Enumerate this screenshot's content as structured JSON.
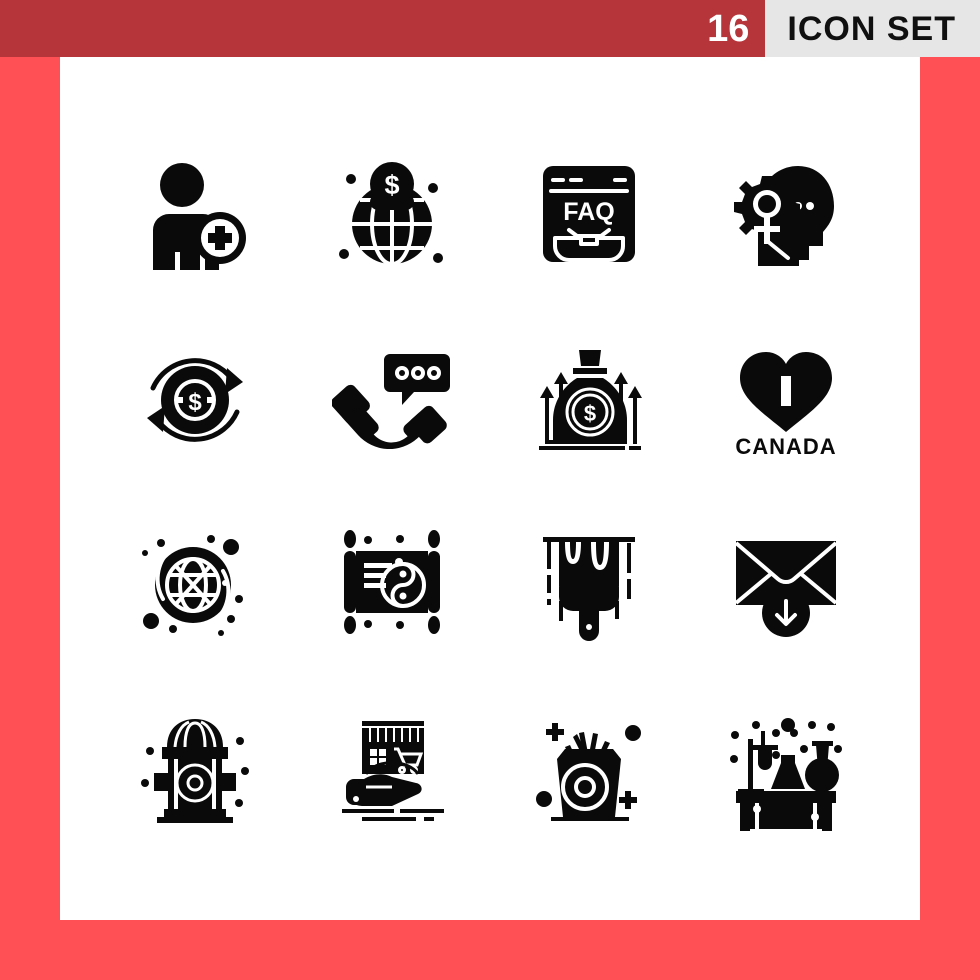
{
  "header": {
    "count": "16",
    "title": "ICON SET",
    "count_bg": "#b5353b",
    "title_bg": "#e6e6e6",
    "title_color": "#101010",
    "count_color": "#ffffff"
  },
  "poster": {
    "border_color": "#ff5056",
    "canvas_color": "#ffffff",
    "icon_color": "#0a0a0a",
    "columns": 4,
    "rows": 4
  },
  "icons": [
    {
      "position": 1,
      "row": 1,
      "col": 1,
      "name": "add-user-icon",
      "label": "Add User"
    },
    {
      "position": 2,
      "row": 1,
      "col": 2,
      "name": "global-finance-icon",
      "label": "Global Finance"
    },
    {
      "position": 3,
      "row": 1,
      "col": 3,
      "name": "faq-browser-icon",
      "label": "FAQ",
      "text": "FAQ"
    },
    {
      "position": 4,
      "row": 1,
      "col": 4,
      "name": "mind-gear-head-icon",
      "label": "Creative Mind"
    },
    {
      "position": 5,
      "row": 2,
      "col": 1,
      "name": "money-refund-icon",
      "label": "Money Refund"
    },
    {
      "position": 6,
      "row": 2,
      "col": 2,
      "name": "phone-support-chat-icon",
      "label": "Phone Support"
    },
    {
      "position": 7,
      "row": 2,
      "col": 3,
      "name": "money-bag-growth-icon",
      "label": "Money Growth"
    },
    {
      "position": 8,
      "row": 2,
      "col": 4,
      "name": "i-love-canada-heart-icon",
      "label": "I Love Canada",
      "text": "CANADA"
    },
    {
      "position": 9,
      "row": 3,
      "col": 1,
      "name": "planet-globe-icon",
      "label": "Planet"
    },
    {
      "position": 10,
      "row": 3,
      "col": 2,
      "name": "yin-yang-scroll-icon",
      "label": "Yin Yang Scroll"
    },
    {
      "position": 11,
      "row": 3,
      "col": 3,
      "name": "paint-brush-drip-icon",
      "label": "Paint Brush"
    },
    {
      "position": 12,
      "row": 3,
      "col": 4,
      "name": "email-download-icon",
      "label": "Receive Email"
    },
    {
      "position": 13,
      "row": 4,
      "col": 1,
      "name": "fire-hydrant-icon",
      "label": "Fire Hydrant"
    },
    {
      "position": 14,
      "row": 4,
      "col": 2,
      "name": "hand-shop-icon",
      "label": "Shop in Hand"
    },
    {
      "position": 15,
      "row": 4,
      "col": 3,
      "name": "french-fries-icon",
      "label": "French Fries"
    },
    {
      "position": 16,
      "row": 4,
      "col": 4,
      "name": "lab-table-icon",
      "label": "Laboratory Table"
    }
  ]
}
